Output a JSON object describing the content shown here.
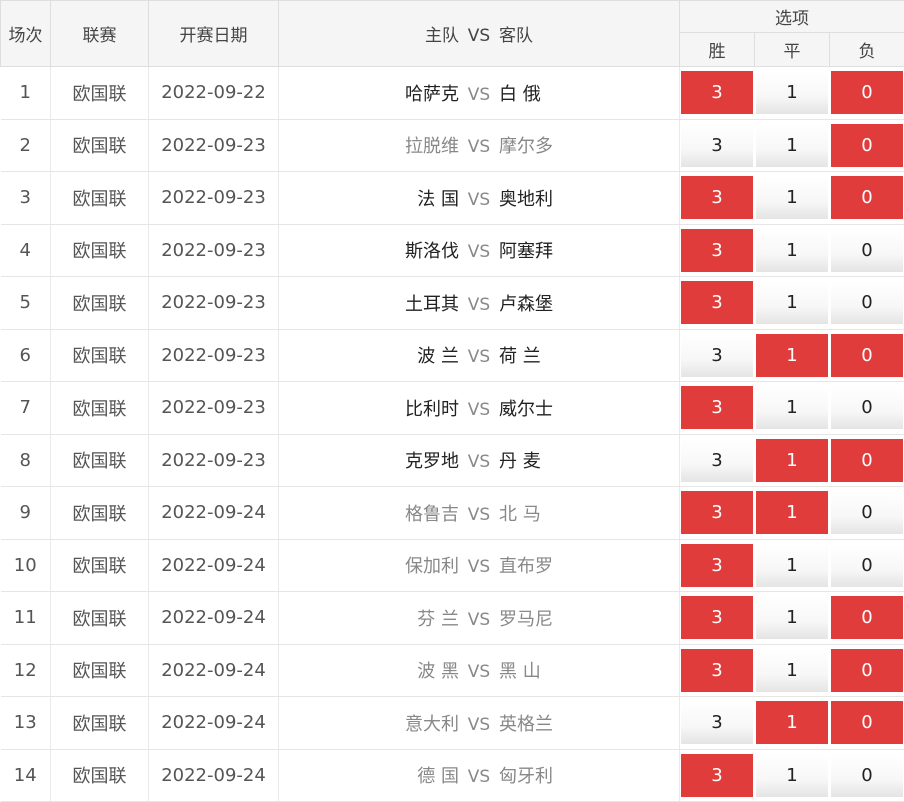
{
  "header": {
    "round": "场次",
    "league": "联赛",
    "date": "开赛日期",
    "match_home": "主队",
    "match_vs": "VS",
    "match_away": "客队",
    "options": "选项",
    "win": "胜",
    "draw": "平",
    "lose": "负"
  },
  "colors": {
    "selected": "#e03c3c",
    "header_bg": "#f5f5f5"
  },
  "rows": [
    {
      "idx": "1",
      "league": "欧国联",
      "date": "2022-09-22",
      "home": "哈萨克",
      "vs": "VS",
      "away": "白 俄",
      "muted": false,
      "win": "3",
      "draw": "1",
      "lose": "0",
      "sel": [
        true,
        false,
        true
      ]
    },
    {
      "idx": "2",
      "league": "欧国联",
      "date": "2022-09-23",
      "home": "拉脱维",
      "vs": "VS",
      "away": "摩尔多",
      "muted": true,
      "win": "3",
      "draw": "1",
      "lose": "0",
      "sel": [
        false,
        false,
        true
      ]
    },
    {
      "idx": "3",
      "league": "欧国联",
      "date": "2022-09-23",
      "home": "法 国",
      "vs": "VS",
      "away": "奥地利",
      "muted": false,
      "win": "3",
      "draw": "1",
      "lose": "0",
      "sel": [
        true,
        false,
        true
      ]
    },
    {
      "idx": "4",
      "league": "欧国联",
      "date": "2022-09-23",
      "home": "斯洛伐",
      "vs": "VS",
      "away": "阿塞拜",
      "muted": false,
      "win": "3",
      "draw": "1",
      "lose": "0",
      "sel": [
        true,
        false,
        false
      ]
    },
    {
      "idx": "5",
      "league": "欧国联",
      "date": "2022-09-23",
      "home": "土耳其",
      "vs": "VS",
      "away": "卢森堡",
      "muted": false,
      "win": "3",
      "draw": "1",
      "lose": "0",
      "sel": [
        true,
        false,
        false
      ]
    },
    {
      "idx": "6",
      "league": "欧国联",
      "date": "2022-09-23",
      "home": "波 兰",
      "vs": "VS",
      "away": "荷 兰",
      "muted": false,
      "win": "3",
      "draw": "1",
      "lose": "0",
      "sel": [
        false,
        true,
        true
      ]
    },
    {
      "idx": "7",
      "league": "欧国联",
      "date": "2022-09-23",
      "home": "比利时",
      "vs": "VS",
      "away": "威尔士",
      "muted": false,
      "win": "3",
      "draw": "1",
      "lose": "0",
      "sel": [
        true,
        false,
        false
      ]
    },
    {
      "idx": "8",
      "league": "欧国联",
      "date": "2022-09-23",
      "home": "克罗地",
      "vs": "VS",
      "away": "丹 麦",
      "muted": false,
      "win": "3",
      "draw": "1",
      "lose": "0",
      "sel": [
        false,
        true,
        true
      ]
    },
    {
      "idx": "9",
      "league": "欧国联",
      "date": "2022-09-24",
      "home": "格鲁吉",
      "vs": "VS",
      "away": "北 马",
      "muted": true,
      "win": "3",
      "draw": "1",
      "lose": "0",
      "sel": [
        true,
        true,
        false
      ]
    },
    {
      "idx": "10",
      "league": "欧国联",
      "date": "2022-09-24",
      "home": "保加利",
      "vs": "VS",
      "away": "直布罗",
      "muted": true,
      "win": "3",
      "draw": "1",
      "lose": "0",
      "sel": [
        true,
        false,
        false
      ]
    },
    {
      "idx": "11",
      "league": "欧国联",
      "date": "2022-09-24",
      "home": "芬 兰",
      "vs": "VS",
      "away": "罗马尼",
      "muted": true,
      "win": "3",
      "draw": "1",
      "lose": "0",
      "sel": [
        true,
        false,
        true
      ]
    },
    {
      "idx": "12",
      "league": "欧国联",
      "date": "2022-09-24",
      "home": "波 黑",
      "vs": "VS",
      "away": "黑 山",
      "muted": true,
      "win": "3",
      "draw": "1",
      "lose": "0",
      "sel": [
        true,
        false,
        true
      ]
    },
    {
      "idx": "13",
      "league": "欧国联",
      "date": "2022-09-24",
      "home": "意大利",
      "vs": "VS",
      "away": "英格兰",
      "muted": true,
      "win": "3",
      "draw": "1",
      "lose": "0",
      "sel": [
        false,
        true,
        true
      ]
    },
    {
      "idx": "14",
      "league": "欧国联",
      "date": "2022-09-24",
      "home": "德 国",
      "vs": "VS",
      "away": "匈牙利",
      "muted": true,
      "win": "3",
      "draw": "1",
      "lose": "0",
      "sel": [
        true,
        false,
        false
      ]
    }
  ]
}
